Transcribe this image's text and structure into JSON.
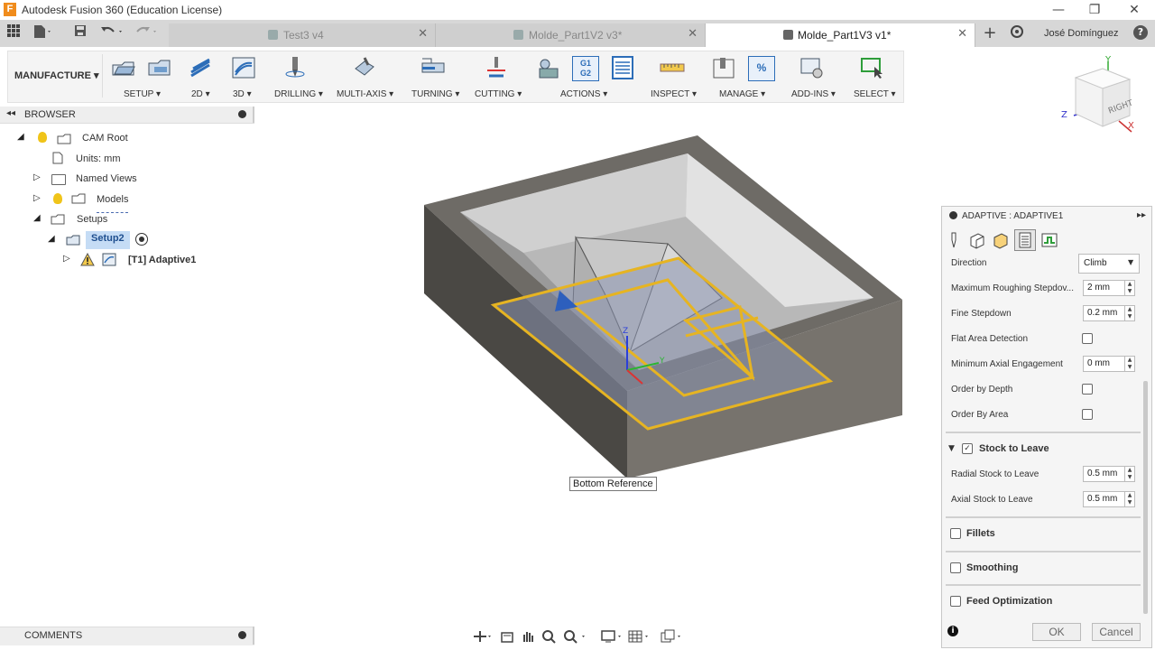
{
  "window": {
    "title": "Autodesk Fusion 360 (Education License)",
    "minimize": "—",
    "restore": "❐",
    "close": "✕"
  },
  "tabs": [
    {
      "label": "Test3 v4",
      "active": false
    },
    {
      "label": "Molde_Part1V2 v3*",
      "active": false
    },
    {
      "label": "Molde_Part1V3 v1*",
      "active": true
    }
  ],
  "user": {
    "name": "José Domínguez",
    "help": "?"
  },
  "toolbar": {
    "workspace": "MANUFACTURE",
    "groups": [
      "SETUP",
      "2D",
      "3D",
      "DRILLING",
      "MULTI-AXIS",
      "TURNING",
      "CUTTING",
      "ACTIONS",
      "INSPECT",
      "MANAGE",
      "ADD-INS",
      "SELECT"
    ],
    "gcode_icon": [
      "G1",
      "G2"
    ],
    "percent_icon": "%"
  },
  "viewcube": {
    "face": "RIGHT",
    "z": "Z",
    "y": "Y",
    "x": "X"
  },
  "browser": {
    "title": "BROWSER",
    "items": [
      {
        "label": "CAM Root"
      },
      {
        "label": "Units: mm"
      },
      {
        "label": "Named Views"
      },
      {
        "label": "Models"
      },
      {
        "label": "Setups"
      },
      {
        "label": "Setup2"
      },
      {
        "label": "[T1] Adaptive1"
      }
    ]
  },
  "viewport": {
    "tooltip": "Bottom Reference",
    "axis_z": "Z",
    "axis_y": "Y"
  },
  "comments": {
    "label": "COMMENTS"
  },
  "panel": {
    "title": "ADAPTIVE : ADAPTIVE1",
    "direction": {
      "label": "Direction",
      "value": "Climb"
    },
    "max_stepdown": {
      "label": "Maximum Roughing Stepdov...",
      "value": "2 mm"
    },
    "fine_stepdown": {
      "label": "Fine Stepdown",
      "value": "0.2 mm"
    },
    "flat_area": {
      "label": "Flat Area Detection"
    },
    "min_axial": {
      "label": "Minimum Axial Engagement",
      "value": "0 mm"
    },
    "order_depth": {
      "label": "Order by Depth"
    },
    "order_area": {
      "label": "Order By Area"
    },
    "stock_section": {
      "label": "Stock to Leave"
    },
    "radial_stock": {
      "label": "Radial Stock to Leave",
      "value": "0.5 mm"
    },
    "axial_stock": {
      "label": "Axial Stock to Leave",
      "value": "0.5 mm"
    },
    "fillets": {
      "label": "Fillets"
    },
    "smoothing": {
      "label": "Smoothing"
    },
    "feed_opt": {
      "label": "Feed Optimization"
    },
    "ok": "OK",
    "cancel": "Cancel",
    "info": "i"
  }
}
